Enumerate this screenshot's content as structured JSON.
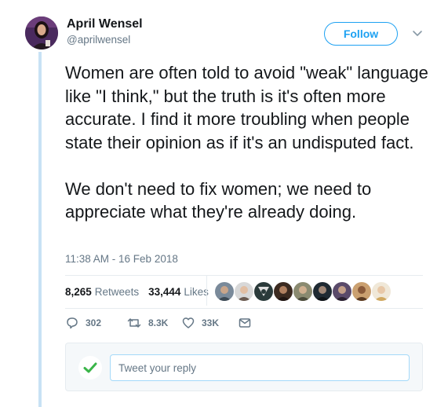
{
  "author": {
    "name": "April Wensel",
    "handle": "@aprilwensel"
  },
  "header": {
    "follow_label": "Follow",
    "menu_icon": "chevron-down-icon"
  },
  "tweet": {
    "paragraphs": [
      "Women are often told to avoid \"weak\" language like \"I think,\" but the truth is it's often more accurate. I find it more troubling when people state their opinion as if it's an undisputed fact.",
      "We don't need to fix women; we need to appreciate what they're already doing."
    ],
    "timestamp": "11:38 AM - 16 Feb 2018"
  },
  "stats": {
    "retweets_count": "8,265",
    "retweets_label": "Retweets",
    "likes_count": "33,444",
    "likes_label": "Likes"
  },
  "actions": {
    "replies": "302",
    "retweets": "8.3K",
    "likes": "33K"
  },
  "reply": {
    "placeholder": "Tweet your reply"
  },
  "colors": {
    "accent": "#1da1f2",
    "text": "#14171a",
    "muted": "#657786",
    "thread_line": "#c8e2f5",
    "check_green": "#3ab549"
  }
}
